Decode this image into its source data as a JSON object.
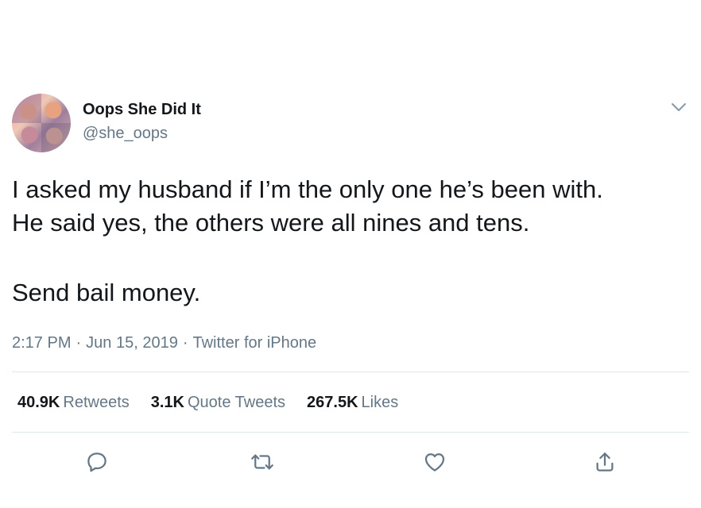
{
  "user": {
    "display_name": "Oops She Did It",
    "handle": "@she_oops"
  },
  "tweet": {
    "lines": [
      "I asked my husband if I’m the only one he’s been with.",
      "He said yes, the others were all nines and tens.",
      "Send bail money."
    ]
  },
  "meta": {
    "time": "2:17 PM",
    "date": "Jun 15, 2019",
    "source": "Twitter for iPhone",
    "separator": "·"
  },
  "stats": [
    {
      "value": "40.9K",
      "label": "Retweets"
    },
    {
      "value": "3.1K",
      "label": "Quote Tweets"
    },
    {
      "value": "267.5K",
      "label": "Likes"
    }
  ],
  "icons": {
    "more": "chevron-down-icon",
    "reply": "reply-icon",
    "retweet": "retweet-icon",
    "like": "heart-icon",
    "share": "share-icon"
  },
  "colors": {
    "text": "#14171a",
    "secondary": "#657786",
    "divider": "#e1e8ed"
  }
}
